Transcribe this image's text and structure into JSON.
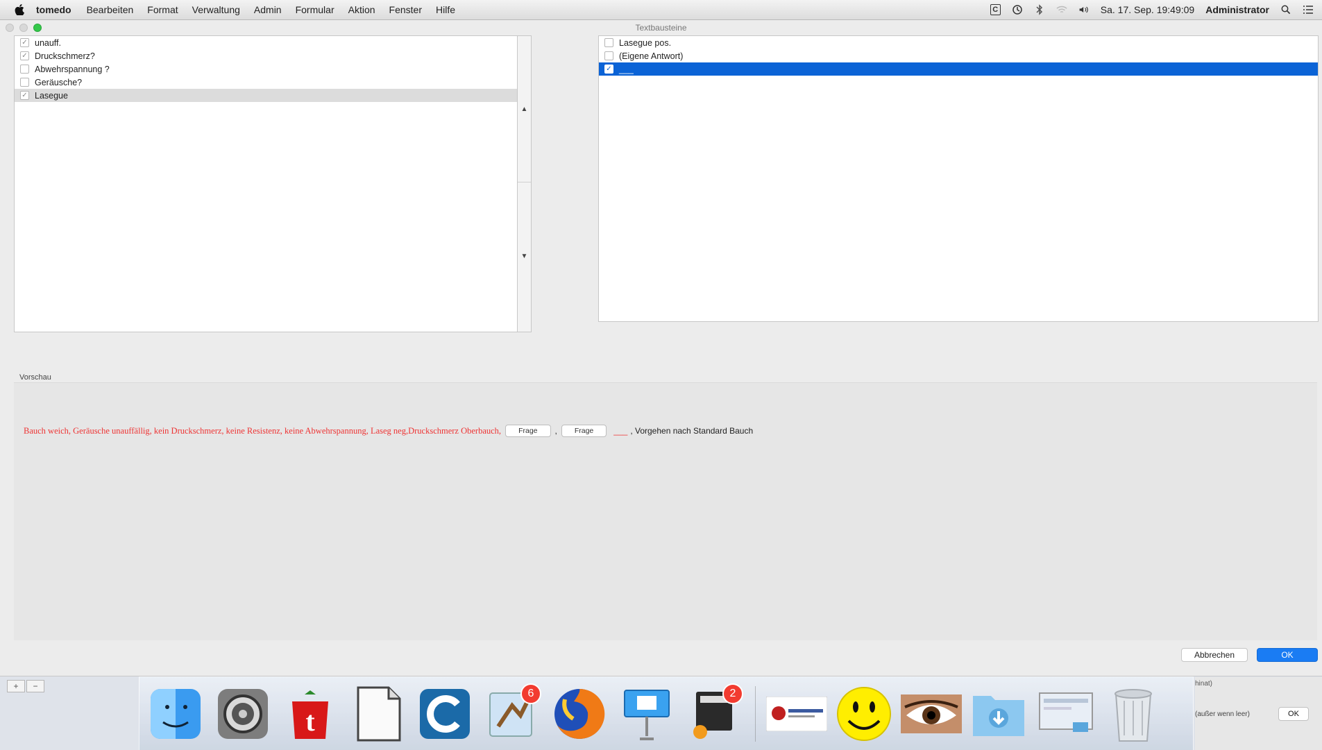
{
  "menubar": {
    "app_name": "tomedo",
    "items": [
      "Bearbeiten",
      "Format",
      "Verwaltung",
      "Admin",
      "Formular",
      "Aktion",
      "Fenster",
      "Hilfe"
    ],
    "clock": "Sa. 17. Sep. 19:49:09",
    "user": "Administrator",
    "icons": [
      "c-box-icon",
      "time-machine-icon",
      "bluetooth-icon",
      "wifi-icon",
      "volume-icon",
      "search-icon",
      "list-icon"
    ]
  },
  "window": {
    "title": "Textbausteine",
    "left_list": [
      {
        "label": "unauff.",
        "checked": true,
        "selected": false
      },
      {
        "label": "Druckschmerz?",
        "checked": true,
        "selected": false
      },
      {
        "label": "Abwehrspannung ?",
        "checked": false,
        "selected": false
      },
      {
        "label": "Geräusche?",
        "checked": false,
        "selected": false
      },
      {
        "label": "Lasegue",
        "checked": true,
        "selected": true
      }
    ],
    "right_list": [
      {
        "label": "Lasegue pos.",
        "checked": false,
        "selected": false
      },
      {
        "label": "(Eigene Antwort)",
        "checked": false,
        "selected": false
      },
      {
        "label": "___",
        "checked": true,
        "selected": true
      }
    ],
    "preview_label": "Vorschau",
    "preview": {
      "red_text": "Bauch weich, Geräusche unauffällig, kein Druckschmerz, keine Resistenz, keine Abwehrspannung, Laseg neg,Druckschmerz Oberbauch,",
      "frage_1": "Frage",
      "frage_2": "Frage",
      "separator": ",",
      "blank": "___",
      "tail": ", Vorgehen nach Standard Bauch"
    },
    "cancel_label": "Abbrechen",
    "ok_label": "OK"
  },
  "background": {
    "right_field": "hinat)",
    "right_hint": "(außer wenn leer)",
    "right_ok": "OK"
  },
  "dock": {
    "mail_badge": "6",
    "printer_badge": "2"
  },
  "colors": {
    "selection_blue": "#0b63d6",
    "ok_blue": "#1a7cf3",
    "preview_red": "#e33333",
    "badge_red": "#f23b30"
  }
}
